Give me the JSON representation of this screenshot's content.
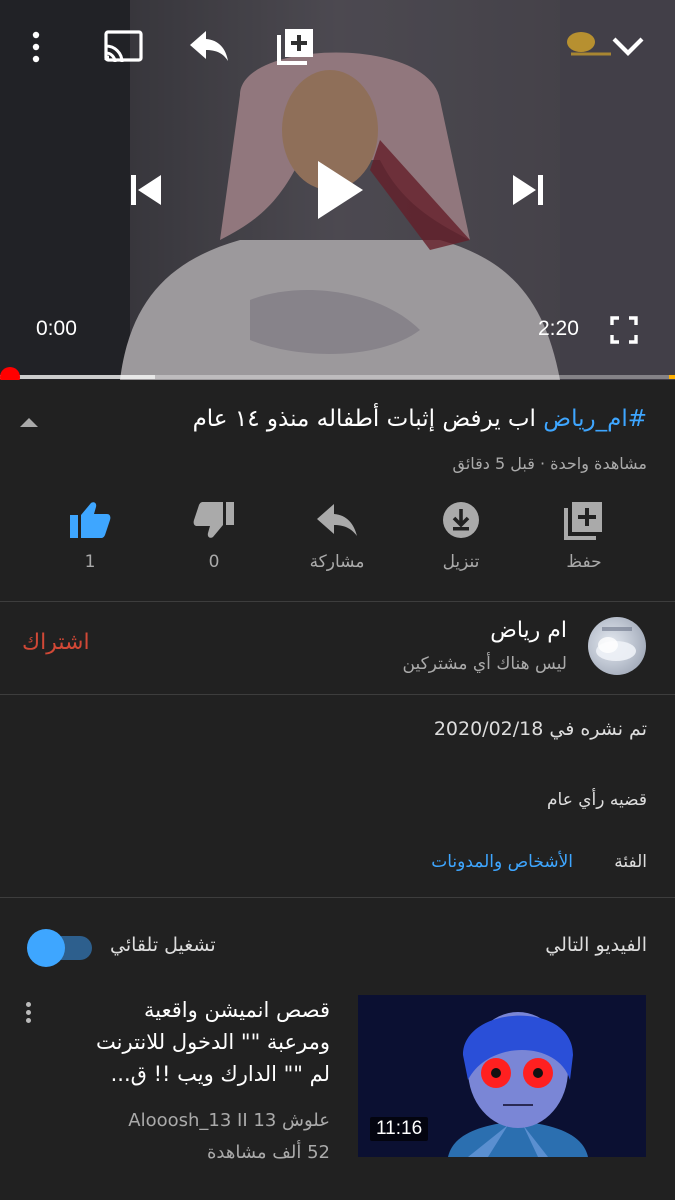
{
  "player": {
    "time_current": "0:00",
    "time_total": "2:20",
    "progress_fraction": 0.0,
    "buffered_fraction": 0.23,
    "icons": [
      "more-vert-icon",
      "cast-icon",
      "share-icon",
      "add-to-playlist-icon",
      "collapse-chevron-icon",
      "previous-icon",
      "play-icon",
      "next-icon",
      "fullscreen-icon"
    ],
    "accent_color": "#ff0000"
  },
  "video": {
    "hashtag": "#ام_رياض",
    "title_text": " اب يرفض إثبات أطفاله منذو ١٤ عام",
    "meta": "مشاهدة واحدة · قبل 5 دقائق"
  },
  "actions": [
    {
      "id": "like",
      "count": "1",
      "icon": "thumb-up-icon",
      "color": "#3ea6ff"
    },
    {
      "id": "dislike",
      "count": "0",
      "icon": "thumb-down-icon",
      "color": "#aaaaaa"
    },
    {
      "id": "share",
      "label": "مشاركة",
      "icon": "share-icon",
      "color": "#aaaaaa"
    },
    {
      "id": "download",
      "label": "تنزيل",
      "icon": "download-icon",
      "color": "#aaaaaa"
    },
    {
      "id": "save",
      "label": "حفظ",
      "icon": "add-to-playlist-icon",
      "color": "#aaaaaa"
    }
  ],
  "channel": {
    "name": "ام رياض",
    "subscribers": "ليس هناك أي مشتركين",
    "subscribe_label": "اشتراك",
    "subscribe_color": "#d14836"
  },
  "description": {
    "published": "تم نشره في 2020/02/18",
    "text": "قضيه رأي عام",
    "category_label": "الفئة",
    "category_value": "الأشخاص والمدونات"
  },
  "up_next": {
    "heading": "الفيديو التالي",
    "autoplay_label": "تشغيل تلقائي",
    "autoplay_on": true,
    "item": {
      "title": "قصص انميشن واقعية ومرعبة \"\" الدخول للانترنت لم \"\" الدارك ويب !! ق...",
      "channel": "علوش Alooosh_13 II 13",
      "views": "52 ألف مشاهدة",
      "duration": "11:16"
    }
  }
}
